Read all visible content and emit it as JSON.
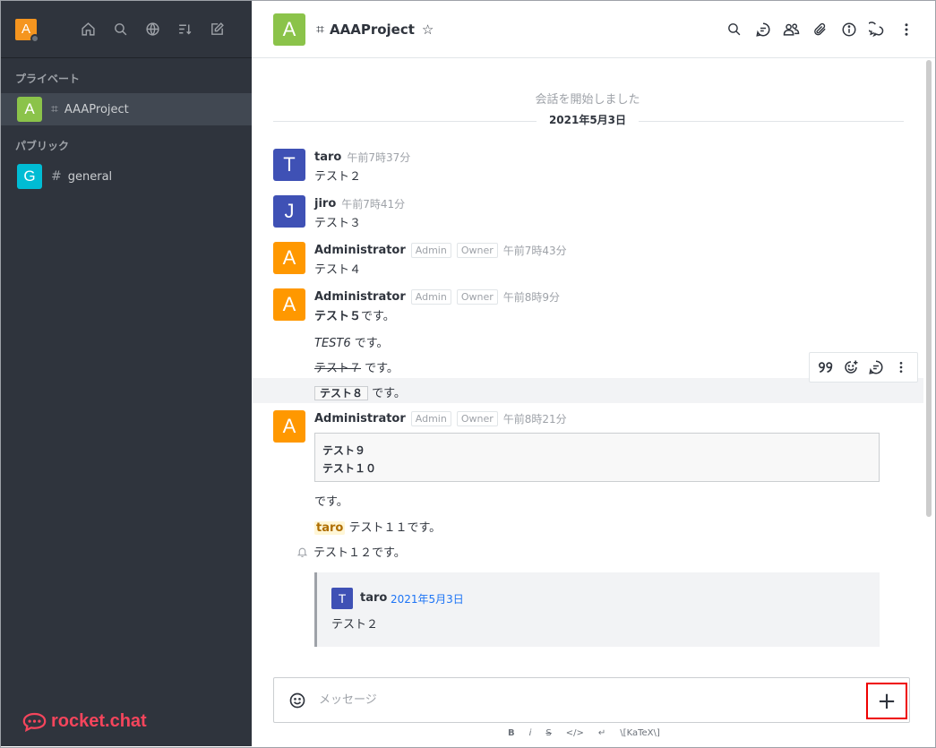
{
  "sidebar": {
    "user_initial": "A",
    "sections": {
      "private": "プライベート",
      "public": "パブリック"
    },
    "rooms": [
      {
        "initial": "A",
        "name": "AAAProject",
        "color": "#8bc34a"
      },
      {
        "initial": "G",
        "name": "general",
        "color": "#00bcd4"
      }
    ],
    "logo_text": "rocket.chat",
    "top_icons": [
      "home-icon",
      "search-icon",
      "directory-icon",
      "sort-icon",
      "create-new-icon"
    ]
  },
  "header": {
    "initial": "A",
    "room_name": "AAAProject",
    "icons": [
      "search-icon",
      "threads-icon",
      "members-icon",
      "files-icon",
      "info-icon",
      "discussion-icon",
      "kebab-icon"
    ]
  },
  "messages": {
    "start_text": "会話を開始しました",
    "date": "2021年5月3日",
    "list": [
      {
        "initial": "T",
        "user": "taro",
        "time": "午前7時37分",
        "text": "テスト２",
        "color": "#3f51b5"
      },
      {
        "initial": "J",
        "user": "jiro",
        "time": "午前7時41分",
        "text": "テスト３",
        "color": "#3f51b5"
      },
      {
        "initial": "A",
        "user": "Administrator",
        "roles": [
          "Admin",
          "Owner"
        ],
        "time": "午前7時43分",
        "text": "テスト４",
        "color": "#ff9800"
      },
      {
        "initial": "A",
        "user": "Administrator",
        "roles": [
          "Admin",
          "Owner"
        ],
        "time": "午前8時9分",
        "color": "#ff9800"
      },
      {
        "initial": "A",
        "user": "Administrator",
        "roles": [
          "Admin",
          "Owner"
        ],
        "time": "午前8時21分",
        "color": "#ff9800"
      }
    ],
    "m4_lines": {
      "l1_bold": "テスト５",
      "l1_rest": "です。",
      "l2_italic": "TEST6",
      "l2_rest": " です。",
      "l3_strike": "テスト７",
      "l3_rest": " です。",
      "l4_code": "テスト８",
      "l4_rest": " です。"
    },
    "m5_lines": {
      "code_line1": "テスト９",
      "code_line2": "テスト１０",
      "after_code": "です。",
      "mention": "taro",
      "mention_rest": " テスト１１です。",
      "bell_text": "テスト１２です。"
    },
    "quote": {
      "initial": "T",
      "user": "taro",
      "date": "2021年5月3日",
      "text": "テスト２"
    }
  },
  "composer": {
    "placeholder": "メッセージ",
    "plus": "+",
    "format_bold": "B",
    "format_italic": "i",
    "format_strike": "S",
    "format_code": "</>",
    "format_katex": "\\[KaTeX\\]"
  }
}
